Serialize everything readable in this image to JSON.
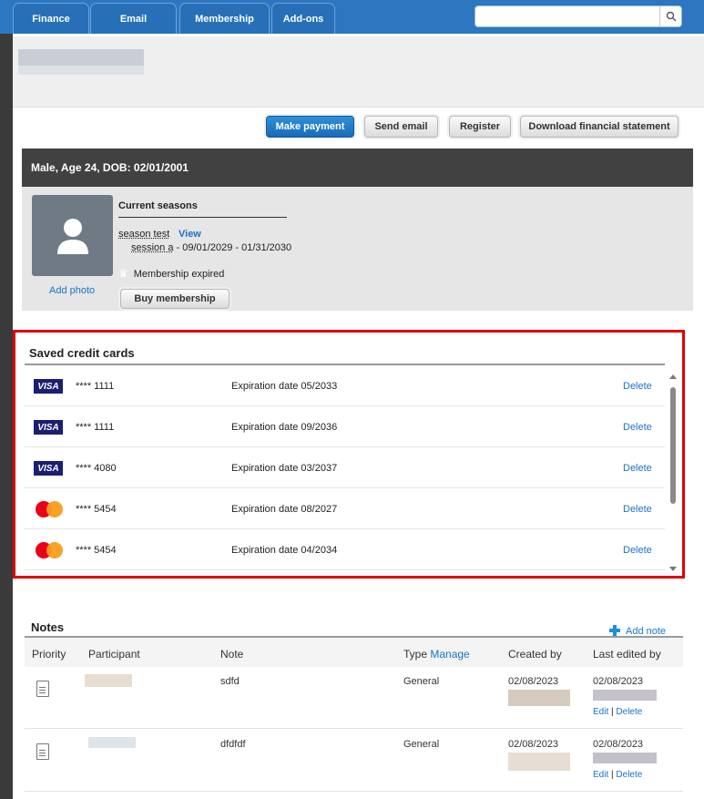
{
  "nav": {
    "tabs": [
      "Finance",
      "Email",
      "Membership",
      "Add-ons"
    ]
  },
  "actions": {
    "make_payment": "Make payment",
    "send_email": "Send email",
    "register": "Register",
    "download": "Download financial statement"
  },
  "profile": {
    "header": "Male, Age 24, DOB: 02/01/2001",
    "add_photo": "Add photo",
    "current_seasons": "Current seasons",
    "season_name": "season test",
    "view_link": "View",
    "session_name": "session a",
    "session_dates": " - 09/01/2029 - 01/31/2030",
    "membership_status": "Membership expired",
    "buy_membership": "Buy membership"
  },
  "cards": {
    "title": "Saved credit cards",
    "delete_label": "Delete",
    "rows": [
      {
        "brand": "visa",
        "brand_label": "VISA",
        "number": "**** 1111",
        "expiration": "Expiration date 05/2033"
      },
      {
        "brand": "visa",
        "brand_label": "VISA",
        "number": "**** 1111",
        "expiration": "Expiration date 09/2036"
      },
      {
        "brand": "visa",
        "brand_label": "VISA",
        "number": "**** 4080",
        "expiration": "Expiration date 03/2037"
      },
      {
        "brand": "mastercard",
        "number": "**** 5454",
        "expiration": "Expiration date 08/2027"
      },
      {
        "brand": "mastercard",
        "number": "**** 5454",
        "expiration": "Expiration date 04/2034"
      }
    ]
  },
  "notes": {
    "title": "Notes",
    "add_note": "Add note",
    "columns": {
      "priority": "Priority",
      "participant": "Participant",
      "note": "Note",
      "type": "Type",
      "manage": "Manage",
      "created_by": "Created by",
      "last_edited_by": "Last edited by"
    },
    "rows": [
      {
        "note": "sdfd",
        "type": "General",
        "created": "02/08/2023",
        "edited": "02/08/2023"
      },
      {
        "note": "dfdfdf",
        "type": "General",
        "created": "02/08/2023",
        "edited": "02/08/2023"
      }
    ],
    "edit_label": "Edit",
    "separator": "|",
    "delete_label": "Delete"
  }
}
